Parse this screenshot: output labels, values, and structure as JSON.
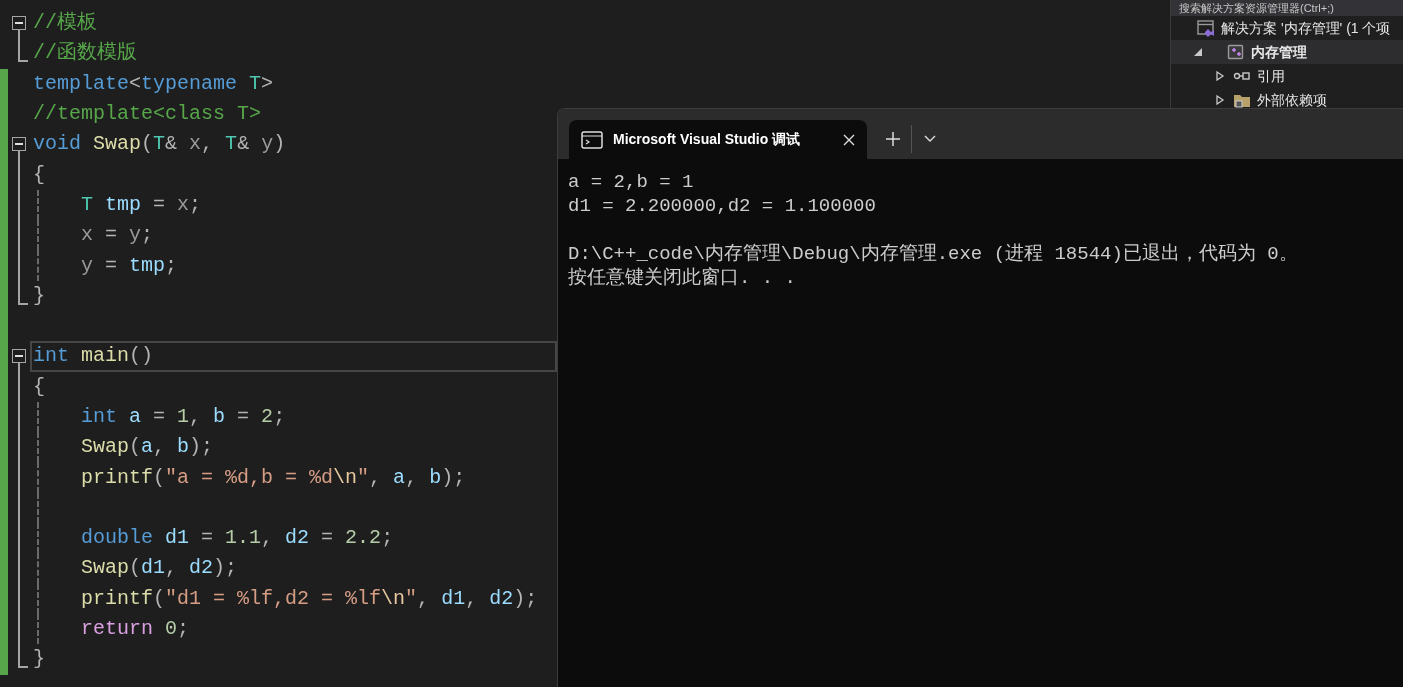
{
  "editor": {
    "lines": [
      {
        "kind": "opener",
        "modified": false,
        "guide": false,
        "current": false,
        "indented": false,
        "tokens": [
          {
            "text": "//模板",
            "kind": "comment"
          }
        ]
      },
      {
        "kind": "closer",
        "modified": false,
        "guide": false,
        "current": false,
        "indented": false,
        "tokens": [
          {
            "text": "//函数模版",
            "kind": "comment"
          }
        ]
      },
      {
        "kind": "plain",
        "modified": true,
        "guide": false,
        "current": false,
        "indented": false,
        "tokens": [
          {
            "text": "template",
            "kind": "keyword"
          },
          {
            "text": "<",
            "kind": "punct"
          },
          {
            "text": "typename",
            "kind": "keyword"
          },
          {
            "text": " T",
            "kind": "type"
          },
          {
            "text": ">",
            "kind": "punct"
          }
        ]
      },
      {
        "kind": "plain",
        "modified": true,
        "guide": false,
        "current": false,
        "indented": false,
        "tokens": [
          {
            "text": "//template<class T>",
            "kind": "comment"
          }
        ]
      },
      {
        "kind": "opener",
        "modified": true,
        "guide": false,
        "current": false,
        "indented": false,
        "tokens": [
          {
            "text": "void",
            "kind": "keyword"
          },
          {
            "text": " Swap",
            "kind": "function"
          },
          {
            "text": "(",
            "kind": "punct"
          },
          {
            "text": "T",
            "kind": "type"
          },
          {
            "text": "& ",
            "kind": "punct"
          },
          {
            "text": "x",
            "kind": "param"
          },
          {
            "text": ", ",
            "kind": "punct"
          },
          {
            "text": "T",
            "kind": "type"
          },
          {
            "text": "& ",
            "kind": "punct"
          },
          {
            "text": "y",
            "kind": "param"
          },
          {
            "text": ")",
            "kind": "punct"
          }
        ]
      },
      {
        "kind": "body",
        "modified": true,
        "guide": false,
        "current": false,
        "indented": false,
        "tokens": [
          {
            "text": "{",
            "kind": "punct"
          }
        ]
      },
      {
        "kind": "body",
        "modified": true,
        "guide": true,
        "current": false,
        "indented": true,
        "tokens": [
          {
            "text": "T",
            "kind": "type"
          },
          {
            "text": " tmp",
            "kind": "variable"
          },
          {
            "text": " = ",
            "kind": "punct"
          },
          {
            "text": "x",
            "kind": "param"
          },
          {
            "text": ";",
            "kind": "punct"
          }
        ]
      },
      {
        "kind": "body",
        "modified": true,
        "guide": true,
        "current": false,
        "indented": true,
        "tokens": [
          {
            "text": "x",
            "kind": "param"
          },
          {
            "text": " = ",
            "kind": "punct"
          },
          {
            "text": "y",
            "kind": "param"
          },
          {
            "text": ";",
            "kind": "punct"
          }
        ]
      },
      {
        "kind": "body",
        "modified": true,
        "guide": true,
        "current": false,
        "indented": true,
        "tokens": [
          {
            "text": "y",
            "kind": "param"
          },
          {
            "text": " = ",
            "kind": "punct"
          },
          {
            "text": "tmp",
            "kind": "variable"
          },
          {
            "text": ";",
            "kind": "punct"
          }
        ]
      },
      {
        "kind": "closer",
        "modified": true,
        "guide": false,
        "current": false,
        "indented": false,
        "tokens": [
          {
            "text": "}",
            "kind": "punct"
          }
        ]
      },
      {
        "kind": "plain",
        "modified": true,
        "guide": false,
        "current": false,
        "indented": false
      },
      {
        "kind": "opener",
        "modified": true,
        "guide": false,
        "current": true,
        "indented": false,
        "tokens": [
          {
            "text": "int",
            "kind": "keyword"
          },
          {
            "text": " main",
            "kind": "function"
          },
          {
            "text": "()",
            "kind": "punct"
          }
        ]
      },
      {
        "kind": "body",
        "modified": true,
        "guide": false,
        "current": false,
        "indented": false,
        "tokens": [
          {
            "text": "{",
            "kind": "punct"
          }
        ]
      },
      {
        "kind": "body",
        "modified": true,
        "guide": true,
        "current": false,
        "indented": true,
        "tokens": [
          {
            "text": "int",
            "kind": "keyword"
          },
          {
            "text": " a",
            "kind": "variable"
          },
          {
            "text": " = ",
            "kind": "punct"
          },
          {
            "text": "1",
            "kind": "number"
          },
          {
            "text": ", ",
            "kind": "punct"
          },
          {
            "text": "b",
            "kind": "variable"
          },
          {
            "text": " = ",
            "kind": "punct"
          },
          {
            "text": "2",
            "kind": "number"
          },
          {
            "text": ";",
            "kind": "punct"
          }
        ]
      },
      {
        "kind": "body",
        "modified": true,
        "guide": true,
        "current": false,
        "indented": true,
        "tokens": [
          {
            "text": "Swap",
            "kind": "function"
          },
          {
            "text": "(",
            "kind": "punct"
          },
          {
            "text": "a",
            "kind": "variable"
          },
          {
            "text": ", ",
            "kind": "punct"
          },
          {
            "text": "b",
            "kind": "variable"
          },
          {
            "text": ");",
            "kind": "punct"
          }
        ]
      },
      {
        "kind": "body",
        "modified": true,
        "guide": true,
        "current": false,
        "indented": true,
        "tokens": [
          {
            "text": "printf",
            "kind": "function"
          },
          {
            "text": "(",
            "kind": "punct"
          },
          {
            "text": "\"a = %d,b = %d",
            "kind": "string"
          },
          {
            "text": "\\n",
            "kind": "escape"
          },
          {
            "text": "\"",
            "kind": "string"
          },
          {
            "text": ", ",
            "kind": "punct"
          },
          {
            "text": "a",
            "kind": "variable"
          },
          {
            "text": ", ",
            "kind": "punct"
          },
          {
            "text": "b",
            "kind": "variable"
          },
          {
            "text": ");",
            "kind": "punct"
          }
        ]
      },
      {
        "kind": "body",
        "modified": true,
        "guide": true,
        "current": false,
        "indented": false
      },
      {
        "kind": "body",
        "modified": true,
        "guide": true,
        "current": false,
        "indented": true,
        "tokens": [
          {
            "text": "double",
            "kind": "keyword"
          },
          {
            "text": " d1",
            "kind": "variable"
          },
          {
            "text": " = ",
            "kind": "punct"
          },
          {
            "text": "1.1",
            "kind": "number"
          },
          {
            "text": ", ",
            "kind": "punct"
          },
          {
            "text": "d2",
            "kind": "variable"
          },
          {
            "text": " = ",
            "kind": "punct"
          },
          {
            "text": "2.2",
            "kind": "number"
          },
          {
            "text": ";",
            "kind": "punct"
          }
        ]
      },
      {
        "kind": "body",
        "modified": true,
        "guide": true,
        "current": false,
        "indented": true,
        "tokens": [
          {
            "text": "Swap",
            "kind": "function"
          },
          {
            "text": "(",
            "kind": "punct"
          },
          {
            "text": "d1",
            "kind": "variable"
          },
          {
            "text": ", ",
            "kind": "punct"
          },
          {
            "text": "d2",
            "kind": "variable"
          },
          {
            "text": ");",
            "kind": "punct"
          }
        ]
      },
      {
        "kind": "body",
        "modified": true,
        "guide": true,
        "current": false,
        "indented": true,
        "tokens": [
          {
            "text": "printf",
            "kind": "function"
          },
          {
            "text": "(",
            "kind": "punct"
          },
          {
            "text": "\"d1 = %lf,d2 = %lf",
            "kind": "string"
          },
          {
            "text": "\\n",
            "kind": "escape"
          },
          {
            "text": "\"",
            "kind": "string"
          },
          {
            "text": ", ",
            "kind": "punct"
          },
          {
            "text": "d1",
            "kind": "variable"
          },
          {
            "text": ", ",
            "kind": "punct"
          },
          {
            "text": "d2",
            "kind": "variable"
          },
          {
            "text": ");",
            "kind": "punct"
          }
        ]
      },
      {
        "kind": "body",
        "modified": true,
        "guide": true,
        "current": false,
        "indented": true,
        "tokens": [
          {
            "text": "return",
            "kind": "control"
          },
          {
            "text": " 0",
            "kind": "number"
          },
          {
            "text": ";",
            "kind": "punct"
          }
        ]
      },
      {
        "kind": "closer",
        "modified": true,
        "guide": false,
        "current": false,
        "indented": false,
        "tokens": [
          {
            "text": "}",
            "kind": "punct"
          }
        ]
      }
    ]
  },
  "solution_explorer": {
    "search": {
      "placeholder": "搜索解决方案资源管理器(Ctrl+;)"
    },
    "items": [
      {
        "label": "解决方案 '内存管理' (1 个项",
        "kind": "solution",
        "selected": false,
        "children": [
          {
            "label": "内存管理",
            "kind": "project",
            "expanded": true,
            "selected": true,
            "children": [
              {
                "label": "引用",
                "kind": "references",
                "expanded": false,
                "selected": false
              },
              {
                "label": "外部依赖项",
                "kind": "folder",
                "expanded": false,
                "selected": false
              }
            ]
          }
        ]
      }
    ]
  },
  "console": {
    "tabs": [
      {
        "title": "Microsoft Visual Studio 调试",
        "selected": true
      }
    ],
    "output_blocks": [
      [
        "a = 2,b = 1",
        "d1 = 2.200000,d2 = 1.100000"
      ],
      [
        "D:\\C++_code\\内存管理\\Debug\\内存管理.exe (进程 18544)已退出，代码为 0。",
        "按任意键关闭此窗口. . ."
      ]
    ]
  }
}
